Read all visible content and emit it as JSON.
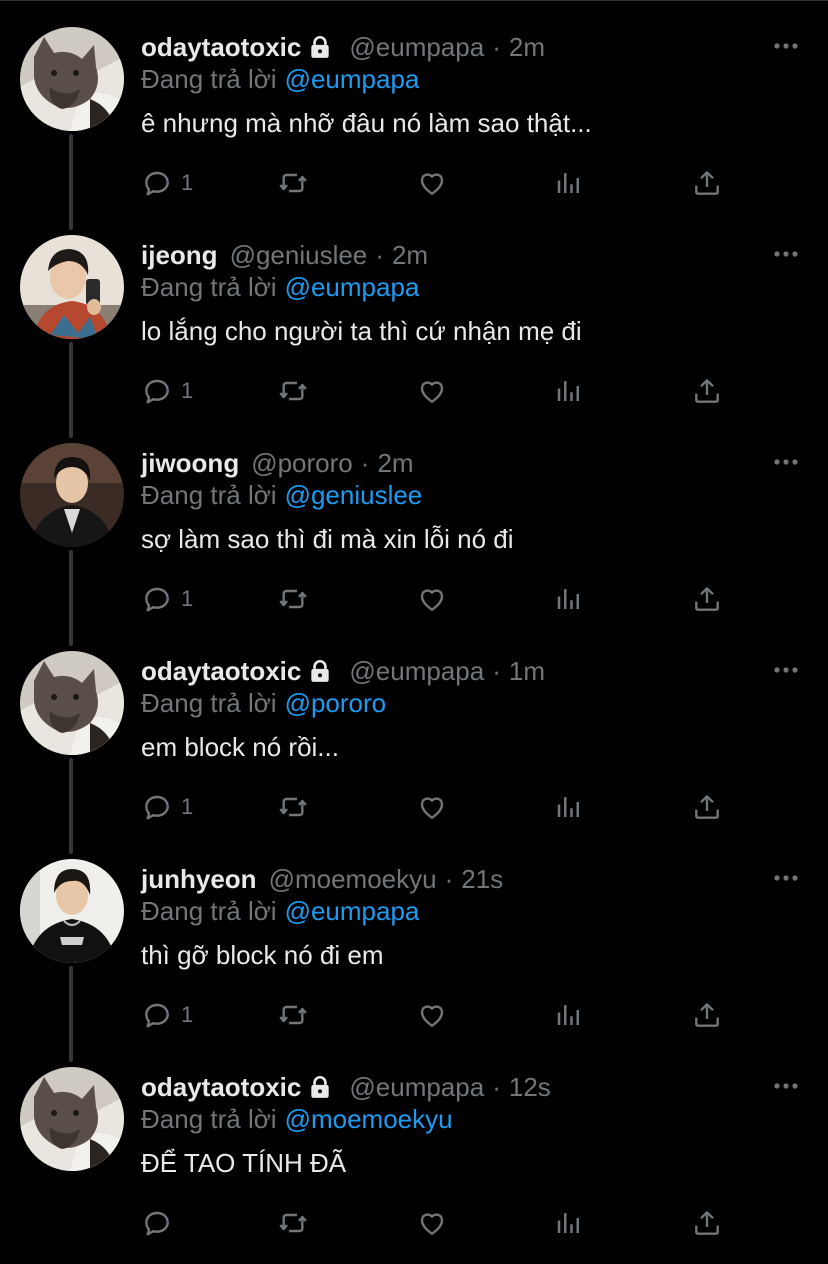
{
  "reply_prefix": "Đang trả lời",
  "colors": {
    "background": "#000000",
    "text": "#e7e9ea",
    "secondary": "#71767b",
    "link": "#1d9bf0",
    "thread_line": "#333639"
  },
  "tweets": [
    {
      "name": "odaytaotoxic",
      "protected": true,
      "handle": "@eumpapa",
      "time": "2m",
      "reply_to": "@eumpapa",
      "text": "ê nhưng mà nhỡ đâu nó làm sao thật...",
      "reply_count": "1",
      "avatar_icon": "cat-avatar-icon"
    },
    {
      "name": "ijeong",
      "protected": false,
      "handle": "@geniuslee",
      "time": "2m",
      "reply_to": "@eumpapa",
      "text": "lo lắng cho người ta thì cứ nhận mẹ đi",
      "reply_count": "1",
      "avatar_icon": "person-selfie-avatar-icon"
    },
    {
      "name": "jiwoong",
      "protected": false,
      "handle": "@pororo",
      "time": "2m",
      "reply_to": "@geniuslee",
      "text": "sợ làm sao thì đi mà xin lỗi nó đi",
      "reply_count": "1",
      "avatar_icon": "person-jacket-avatar-icon"
    },
    {
      "name": "odaytaotoxic",
      "protected": true,
      "handle": "@eumpapa",
      "time": "1m",
      "reply_to": "@pororo",
      "text": "em block nó rồi...",
      "reply_count": "1",
      "avatar_icon": "cat-avatar-icon"
    },
    {
      "name": "junhyeon",
      "protected": false,
      "handle": "@moemoekyu",
      "time": "21s",
      "reply_to": "@eumpapa",
      "text": "thì gỡ block nó đi em",
      "reply_count": "1",
      "avatar_icon": "person-tshirt-avatar-icon"
    },
    {
      "name": "odaytaotoxic",
      "protected": true,
      "handle": "@eumpapa",
      "time": "12s",
      "reply_to": "@moemoekyu",
      "text": "ĐỂ TAO TÍNH ĐÃ",
      "reply_count": "",
      "avatar_icon": "cat-avatar-icon"
    }
  ]
}
